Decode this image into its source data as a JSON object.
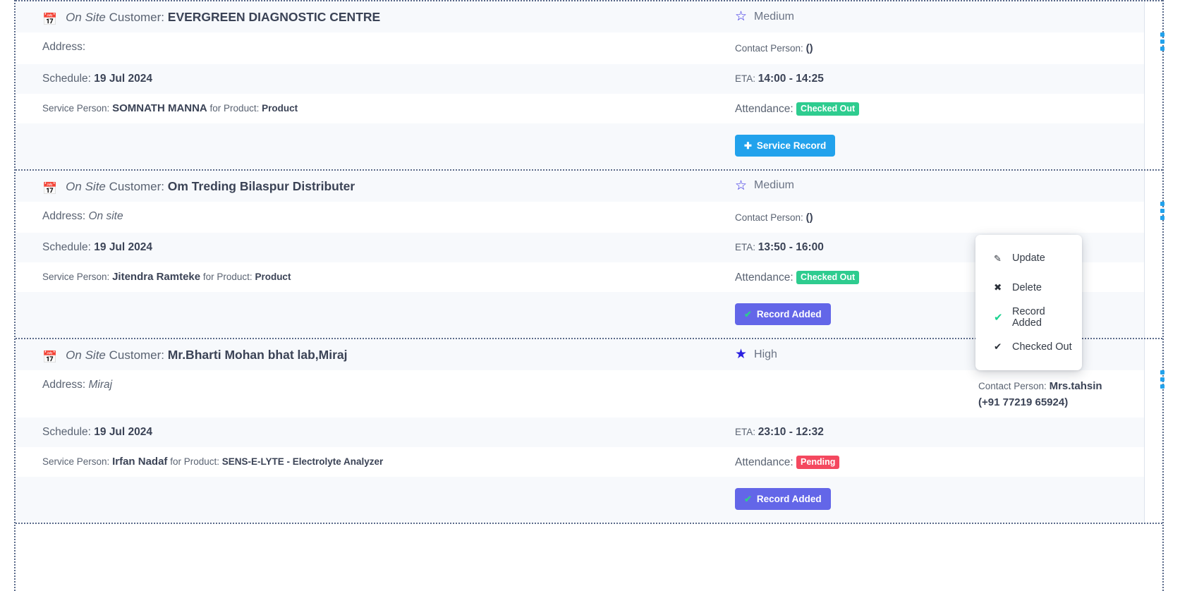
{
  "labels": {
    "on_site": "On Site",
    "customer_prefix": "Customer:",
    "address_prefix": "Address:",
    "schedule_prefix": "Schedule:",
    "service_person_prefix": "Service Person:",
    "for_product_prefix": "for Product:",
    "contact_person_prefix": "Contact Person:",
    "eta_prefix": "ETA:",
    "attendance_prefix": "Attendance:",
    "calendar_icon": "calendar-icon",
    "star_icon": "star-icon",
    "kebab_icon": "kebab-menu-icon"
  },
  "colors": {
    "accent_blue": "#22a2ec",
    "purple": "#6366e8",
    "green": "#2ecc8f",
    "red": "#f4485f",
    "star_blue": "#2a1fe0",
    "text": "#3b4356",
    "muted": "#5a6372",
    "row_shade": "#f7f9fc"
  },
  "cards": [
    {
      "type": "On Site",
      "customer": "EVERGREEN DIAGNOSTIC CENTRE",
      "address": "",
      "schedule": "19 Jul 2024",
      "service_person": "SOMNATH MANNA",
      "product": "Product",
      "priority": "Medium",
      "contact_person": "()",
      "eta": "14:00 - 14:25",
      "attendance": "Checked Out",
      "attendance_color": "green",
      "action_label": "Service Record",
      "action_icon": "plus-icon",
      "action_style": "blue"
    },
    {
      "type": "On Site",
      "customer": "Om Treding Bilaspur Distributer",
      "address": "On site",
      "schedule": "19 Jul 2024",
      "service_person": "Jitendra Ramteke",
      "product": "Product",
      "priority": "Medium",
      "contact_person": "()",
      "eta": "13:50 - 16:00",
      "attendance": "Checked Out",
      "attendance_color": "green",
      "action_label": "Record Added",
      "action_icon": "check-icon",
      "action_style": "purple"
    },
    {
      "type": "On Site",
      "customer": "Mr.Bharti Mohan bhat lab,Miraj",
      "address": "Miraj",
      "schedule": "19 Jul 2024",
      "service_person": "Irfan Nadaf",
      "product": "SENS-E-LYTE - Electrolyte Analyzer",
      "priority": "High",
      "contact_person": "Mrs.tahsin (+91 77219 65924)",
      "eta": "23:10 - 12:32",
      "attendance": "Pending",
      "attendance_color": "red",
      "action_label": "Record Added",
      "action_icon": "check-icon",
      "action_style": "purple"
    }
  ],
  "dropdown": {
    "open_for_card_index": 1,
    "items": [
      {
        "label": "Update",
        "icon": "pencil-icon",
        "icon_glyph": "✎",
        "icon_color": "dark"
      },
      {
        "label": "Delete",
        "icon": "cross-icon",
        "icon_glyph": "✖",
        "icon_color": "dark"
      },
      {
        "label": "Record Added",
        "icon": "check-green-icon",
        "icon_glyph": "✔",
        "icon_color": "green"
      },
      {
        "label": "Checked Out",
        "icon": "check-icon",
        "icon_glyph": "✔",
        "icon_color": "dark"
      }
    ]
  }
}
